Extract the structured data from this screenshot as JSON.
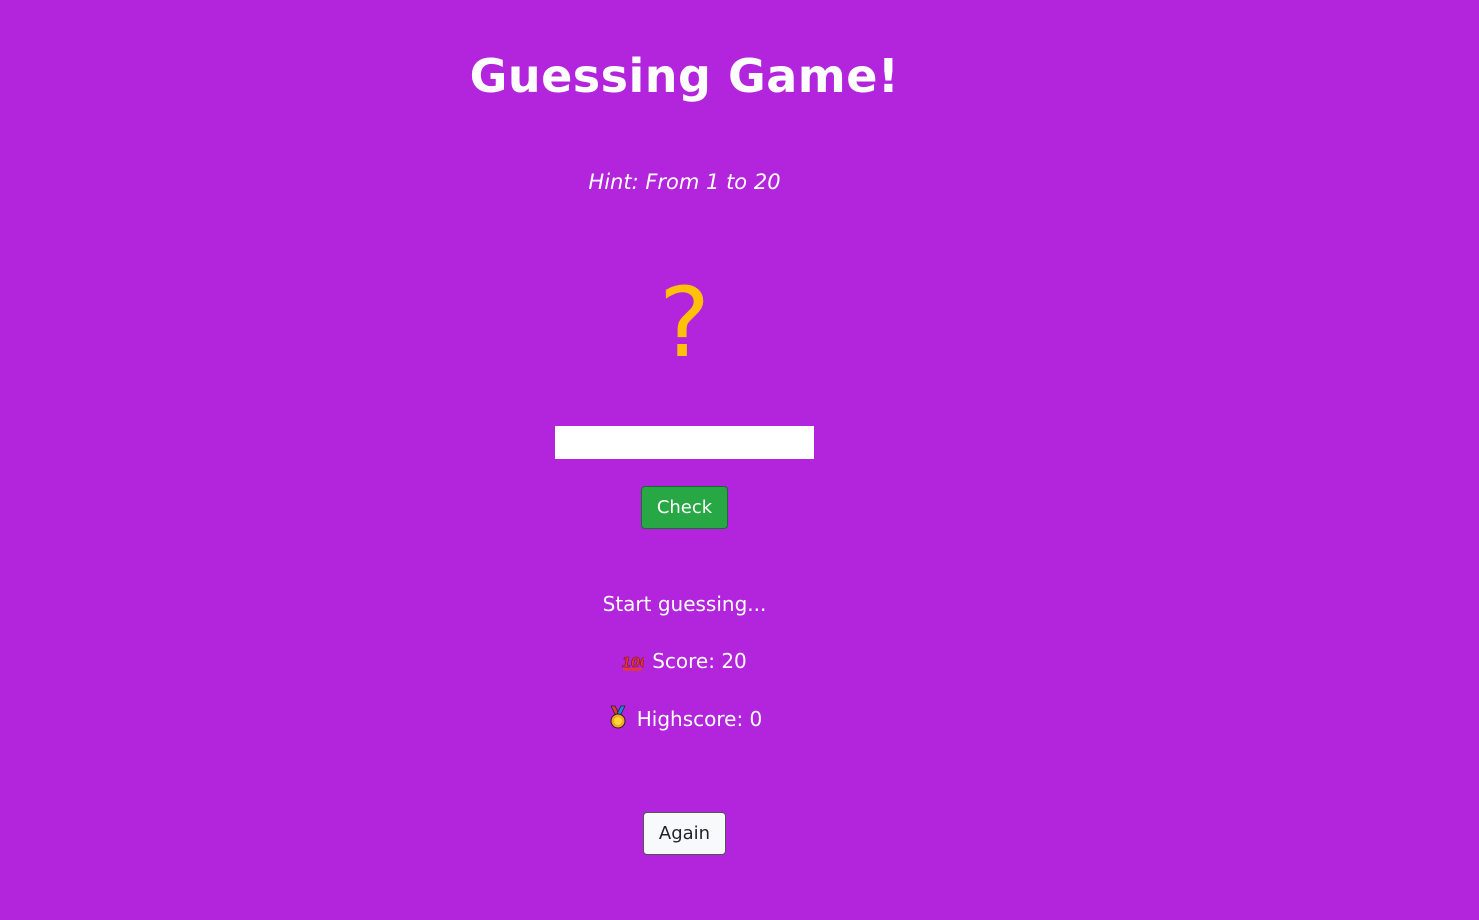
{
  "header": {
    "title": "Guessing Game!",
    "hint": "Hint: From 1 to 20"
  },
  "game": {
    "secret_display": "?",
    "guess_value": "",
    "check_label": "Check",
    "message": "Start guessing...",
    "score_label": "Score: 20",
    "score_icon": "hundred-points-icon",
    "highscore_label": "Highscore: 0",
    "highscore_icon": "medal-icon",
    "again_label": "Again"
  },
  "colors": {
    "background": "#b324dd",
    "accent": "#ffc107",
    "check_button": "#28a745",
    "text": "#ffffff"
  }
}
